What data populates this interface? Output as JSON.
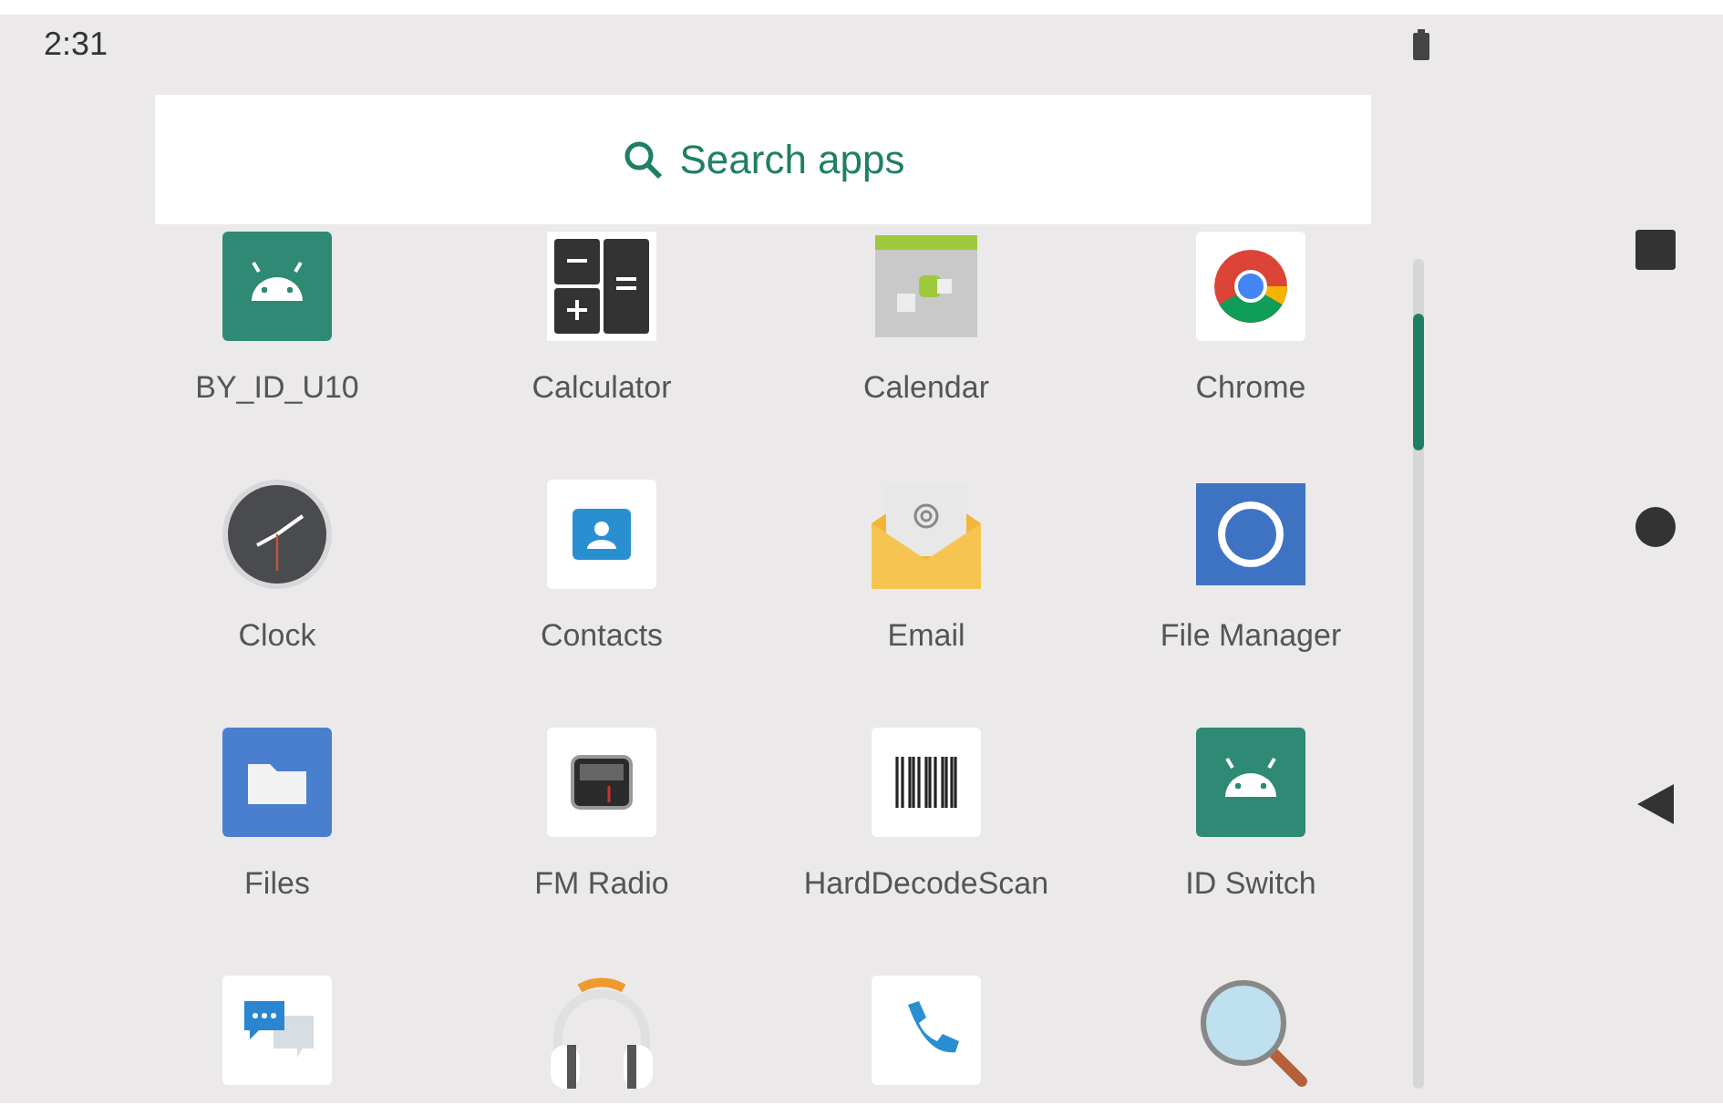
{
  "status_bar": {
    "time": "2:31"
  },
  "search": {
    "placeholder": "Search apps"
  },
  "apps": [
    {
      "kind": "android",
      "label": "BY_ID_U10"
    },
    {
      "kind": "calculator",
      "label": "Calculator"
    },
    {
      "kind": "calendar",
      "label": "Calendar"
    },
    {
      "kind": "chrome",
      "label": "Chrome"
    },
    {
      "kind": "clock",
      "label": "Clock"
    },
    {
      "kind": "contacts",
      "label": "Contacts"
    },
    {
      "kind": "email",
      "label": "Email"
    },
    {
      "kind": "filemanager",
      "label": "File Manager"
    },
    {
      "kind": "files",
      "label": "Files"
    },
    {
      "kind": "radio",
      "label": "FM Radio"
    },
    {
      "kind": "barcode",
      "label": "HardDecodeScan"
    },
    {
      "kind": "android",
      "label": "ID Switch"
    },
    {
      "kind": "messages"
    },
    {
      "kind": "headphones"
    },
    {
      "kind": "phone"
    },
    {
      "kind": "magnifier"
    }
  ]
}
